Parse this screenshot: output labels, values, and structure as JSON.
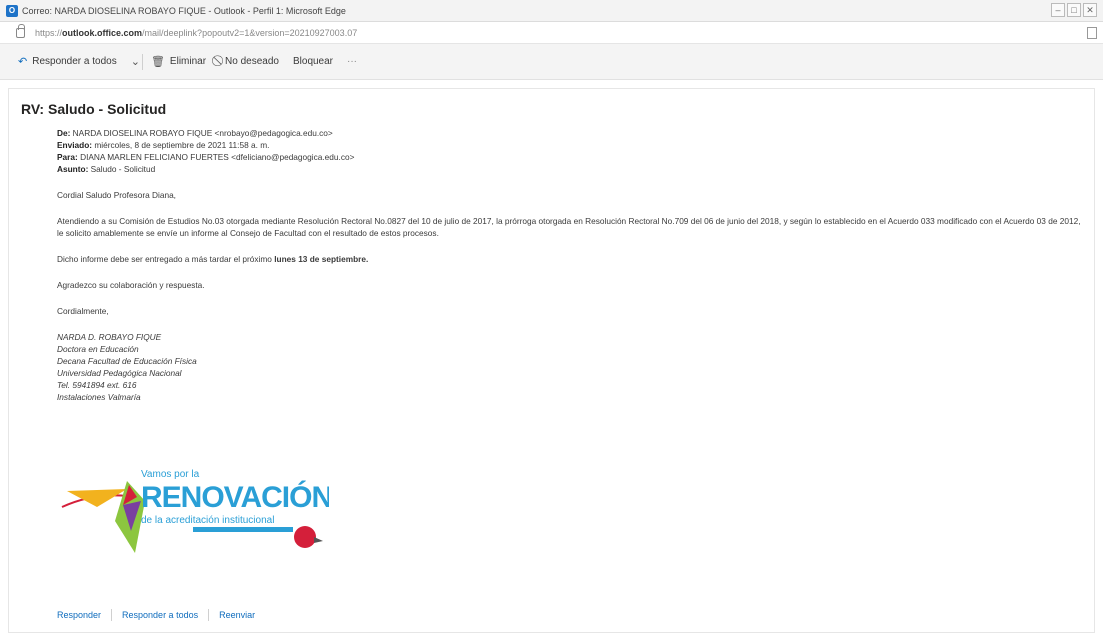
{
  "window": {
    "title": "Correo: NARDA DIOSELINA ROBAYO FIQUE - Outlook - Perfil 1: Microsoft Edge",
    "url_prefix": "https://",
    "url_domain": "outlook.office.com",
    "url_path": "/mail/deeplink?popoutv2=1&version=20210927003.07",
    "controls": [
      "–",
      "□",
      "✕"
    ]
  },
  "toolbar": {
    "reply_all": "Responder a todos",
    "delete": "Eliminar",
    "junk": "No deseado",
    "block": "Bloquear",
    "more": "···"
  },
  "email": {
    "subject": "RV: Saludo - Solicitud",
    "from_label": "De:",
    "from_value": " NARDA DIOSELINA ROBAYO FIQUE <nrobayo@pedagogica.edu.co>",
    "sent_label": "Enviado:",
    "sent_value": " miércoles, 8 de septiembre de 2021 11:58 a. m.",
    "to_label": "Para:",
    "to_value": " DIANA MARLEN FELICIANO FUERTES <dfeliciano@pedagogica.edu.co>",
    "subj_label": "Asunto:",
    "subj_value": " Saludo - Solicitud",
    "greeting": "Cordial Saludo Profesora Diana,",
    "paragraph1": "Atendiendo a su Comisión de Estudios No.03 otorgada mediante Resolución Rectoral No.0827 del 10 de julio de 2017, la prórroga otorgada en Resolución Rectoral No.709 del 06 de junio del 2018, y según lo establecido en el Acuerdo 033 modificado con el Acuerdo 03 de 2012, le solicito amablemente se envíe un informe al Consejo de Facultad con el resultado de estos procesos.",
    "paragraph2_start": "Dicho informe debe ser entregado a más tardar el próximo ",
    "paragraph2_bold": "lunes 13 de septiembre.",
    "thanks": "Agradezco su colaboración y respuesta.",
    "closing": "Cordialmente,",
    "signature": [
      "NARDA D. ROBAYO FIQUE",
      "Doctora en Educación",
      "Decana Facultad de Educación Física",
      "Universidad Pedagógica Nacional",
      "Tel. 5941894 ext. 616",
      "Instalaciones Valmaría"
    ]
  },
  "logo": {
    "line1": "Vamos por la",
    "line2": "RENOVACIÓN",
    "line3": "de la acreditación institucional",
    "colors": {
      "primary": "#2a9fd6",
      "accent_orange": "#f28c1e",
      "accent_green": "#8cc63f",
      "accent_red": "#d41f3a"
    }
  },
  "footer": {
    "reply": "Responder",
    "reply_all": "Responder a todos",
    "forward": "Reenviar"
  }
}
